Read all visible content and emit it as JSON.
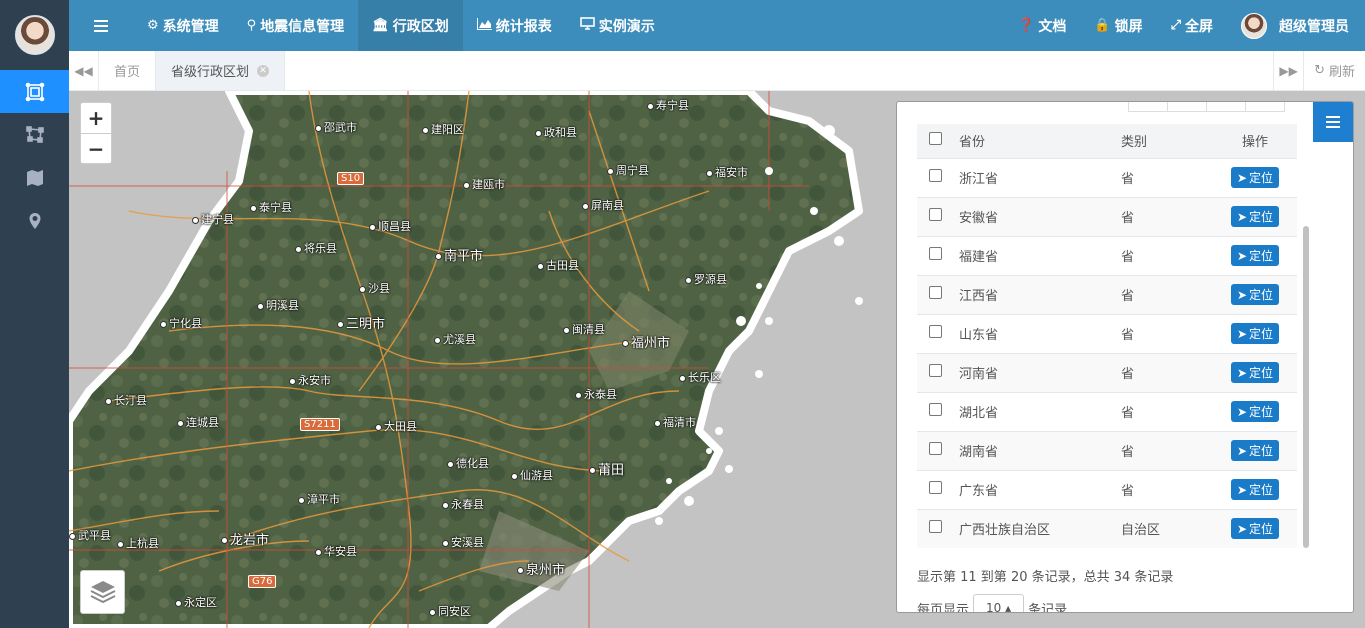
{
  "nav": {
    "items": [
      {
        "icon": "gear-icon",
        "label": "系统管理"
      },
      {
        "icon": "map-pin-icon",
        "label": "地震信息管理"
      },
      {
        "icon": "bank-icon",
        "label": "行政区划"
      },
      {
        "icon": "area-chart-icon",
        "label": "统计报表"
      },
      {
        "icon": "monitor-icon",
        "label": "实例演示"
      }
    ],
    "right": {
      "docs": "文档",
      "lock": "锁屏",
      "fullscreen": "全屏",
      "user": "超级管理员"
    }
  },
  "tabs": {
    "home": "首页",
    "current": "省级行政区划",
    "refresh": "刷新"
  },
  "map": {
    "cities": [
      {
        "name": "邵武市"
      },
      {
        "name": "建阳区"
      },
      {
        "name": "政和县"
      },
      {
        "name": "寿宁县"
      },
      {
        "name": "周宁县"
      },
      {
        "name": "福安市"
      },
      {
        "name": "建瓯市"
      },
      {
        "name": "泰宁县"
      },
      {
        "name": "建宁县"
      },
      {
        "name": "顺昌县"
      },
      {
        "name": "屏南县"
      },
      {
        "name": "将乐县"
      },
      {
        "name": "南平市"
      },
      {
        "name": "古田县"
      },
      {
        "name": "罗源县"
      },
      {
        "name": "沙县"
      },
      {
        "name": "明溪县"
      },
      {
        "name": "宁化县"
      },
      {
        "name": "三明市"
      },
      {
        "name": "尤溪县"
      },
      {
        "name": "闽清县"
      },
      {
        "name": "福州市"
      },
      {
        "name": "长乐区"
      },
      {
        "name": "永安市"
      },
      {
        "name": "永泰县"
      },
      {
        "name": "长汀县"
      },
      {
        "name": "连城县"
      },
      {
        "name": "大田县"
      },
      {
        "name": "福清市"
      },
      {
        "name": "德化县"
      },
      {
        "name": "仙游县"
      },
      {
        "name": "莆田"
      },
      {
        "name": "漳平市"
      },
      {
        "name": "永春县"
      },
      {
        "name": "龙岩市"
      },
      {
        "name": "上杭县"
      },
      {
        "name": "华安县"
      },
      {
        "name": "安溪县"
      },
      {
        "name": "泉州市"
      },
      {
        "name": "永定区"
      },
      {
        "name": "同安区"
      },
      {
        "name": "武平县"
      }
    ],
    "roads": [
      "S10",
      "S7211",
      "G76"
    ]
  },
  "table": {
    "headers": {
      "province": "省份",
      "type": "类别",
      "op": "操作"
    },
    "button_label": "定位",
    "rows": [
      {
        "province": "浙江省",
        "type": "省"
      },
      {
        "province": "安徽省",
        "type": "省"
      },
      {
        "province": "福建省",
        "type": "省"
      },
      {
        "province": "江西省",
        "type": "省"
      },
      {
        "province": "山东省",
        "type": "省"
      },
      {
        "province": "河南省",
        "type": "省"
      },
      {
        "province": "湖北省",
        "type": "省"
      },
      {
        "province": "湖南省",
        "type": "省"
      },
      {
        "province": "广东省",
        "type": "省"
      },
      {
        "province": "广西壮族自治区",
        "type": "自治区"
      }
    ],
    "footer": "显示第 11 到第 20 条记录，总共 34 条记录",
    "per_page_prefix": "每页显示",
    "per_page_value": "10",
    "per_page_suffix": "条记录"
  }
}
